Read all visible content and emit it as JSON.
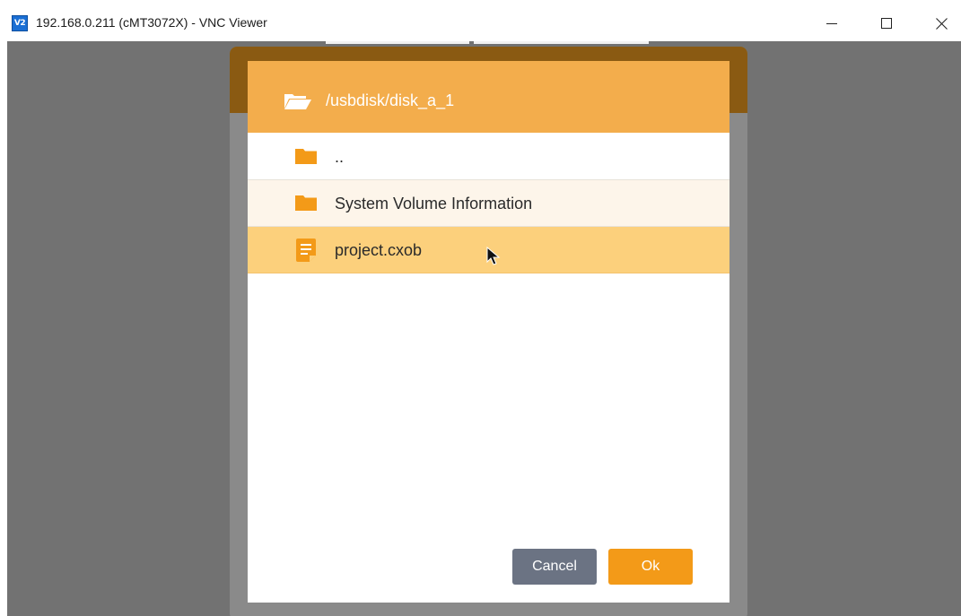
{
  "window": {
    "title": "192.168.0.211 (cMT3072X) - VNC Viewer",
    "app_icon_text": "V2",
    "controls": {
      "minimize_icon": "minimize-icon",
      "maximize_icon": "maximize-icon",
      "close_icon": "close-icon"
    }
  },
  "dialog": {
    "path": "/usbdisk/disk_a_1",
    "header_icon": "folder-open-icon",
    "items": [
      {
        "label": "..",
        "type": "folder",
        "icon": "folder-icon"
      },
      {
        "label": "System Volume Information",
        "type": "folder",
        "icon": "folder-icon"
      },
      {
        "label": "project.cxob",
        "type": "file",
        "icon": "file-icon",
        "selected": true
      }
    ],
    "buttons": {
      "cancel_label": "Cancel",
      "ok_label": "Ok"
    }
  },
  "colors": {
    "header": "#f3ad4c",
    "selected_row": "#fcd07c",
    "folder_row": "#fdf5ea",
    "icon_orange": "#f39a18",
    "cancel_button": "#6b7383",
    "ok_button": "#f39a18",
    "remote_background": "#727272"
  }
}
